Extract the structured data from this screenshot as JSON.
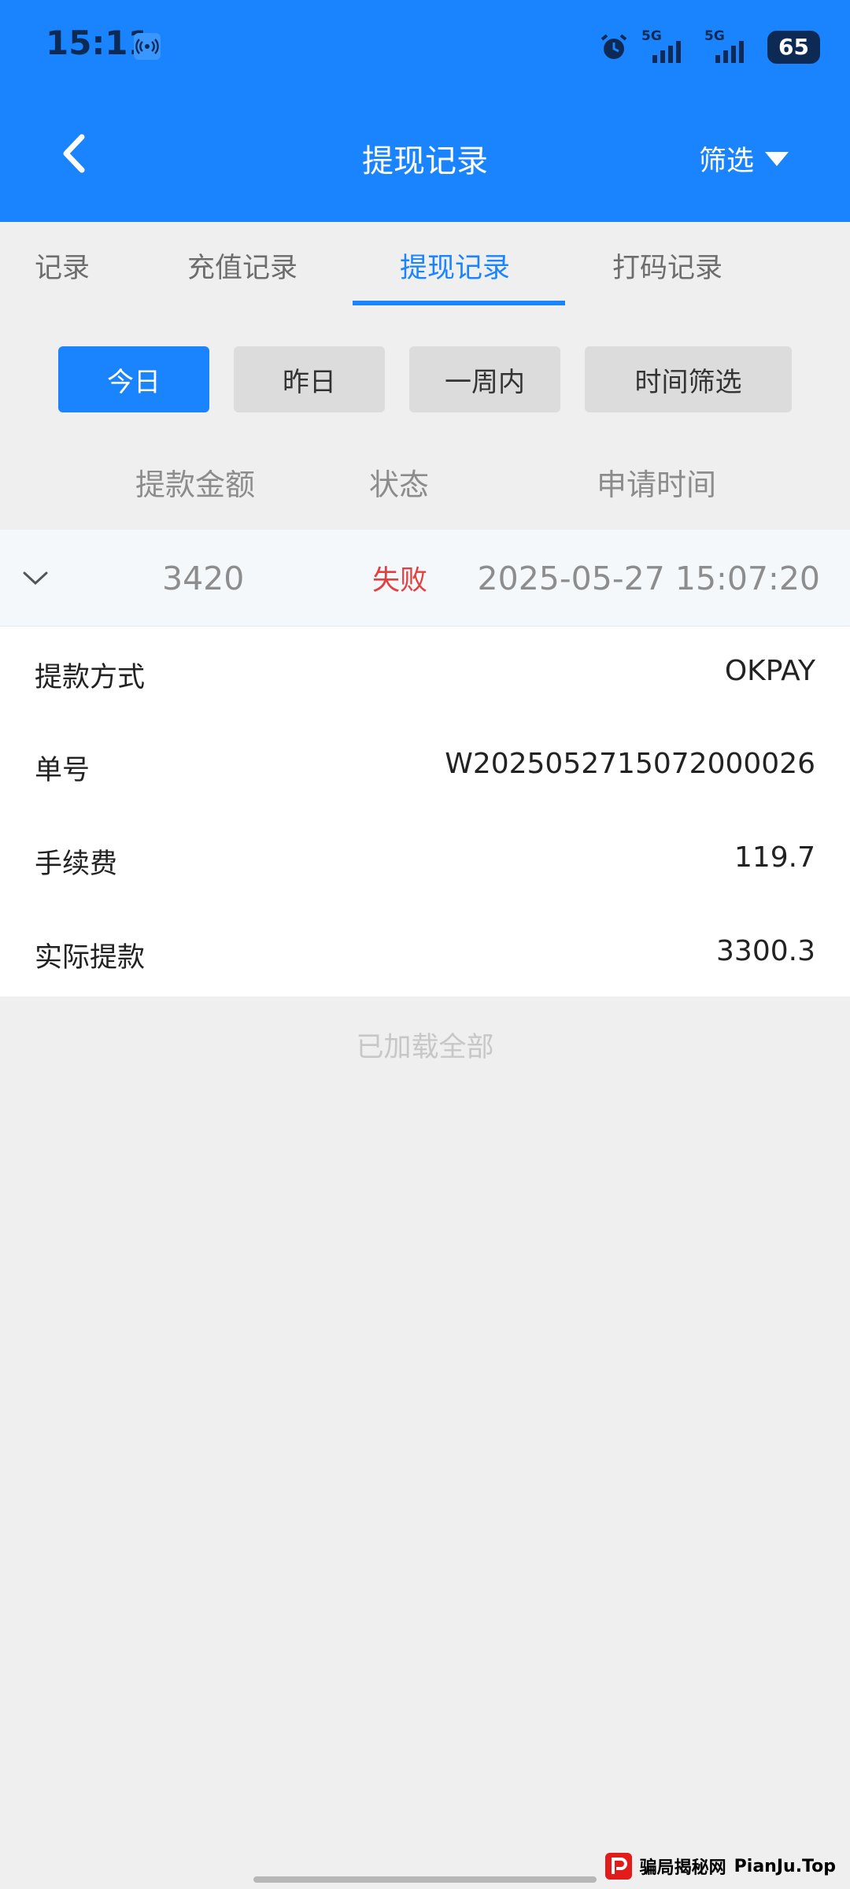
{
  "status_bar": {
    "time": "15:11",
    "network_1": "5G",
    "network_2": "5G",
    "battery": "65",
    "icons": [
      "hotspot-icon",
      "alarm-icon",
      "signal-icon",
      "battery-icon"
    ]
  },
  "header": {
    "title": "提现记录",
    "filter_label": "筛选",
    "background": "#1a84ff"
  },
  "tabs": [
    {
      "label": "记录",
      "active": false
    },
    {
      "label": "充值记录",
      "active": false
    },
    {
      "label": "提现记录",
      "active": true
    },
    {
      "label": "打码记录",
      "active": false
    }
  ],
  "date_filters": [
    {
      "label": "今日",
      "active": true
    },
    {
      "label": "昨日",
      "active": false
    },
    {
      "label": "一周内",
      "active": false
    },
    {
      "label": "时间筛选",
      "active": false
    }
  ],
  "columns": [
    "提款金额",
    "状态",
    "申请时间"
  ],
  "record": {
    "amount": "3420",
    "status": "失败",
    "status_color": "#e53e3e",
    "time": "2025-05-27 15:07:20",
    "details": [
      {
        "label": "提款方式",
        "value": "OKPAY"
      },
      {
        "label": "单号",
        "value": "W2025052715072000026"
      },
      {
        "label": "手续费",
        "value": "119.7"
      },
      {
        "label": "实际提款",
        "value": "3300.3"
      }
    ]
  },
  "footer_text": "已加载全部",
  "watermark": {
    "site_name": "骗局揭秘网",
    "domain": "PianJu.Top"
  }
}
